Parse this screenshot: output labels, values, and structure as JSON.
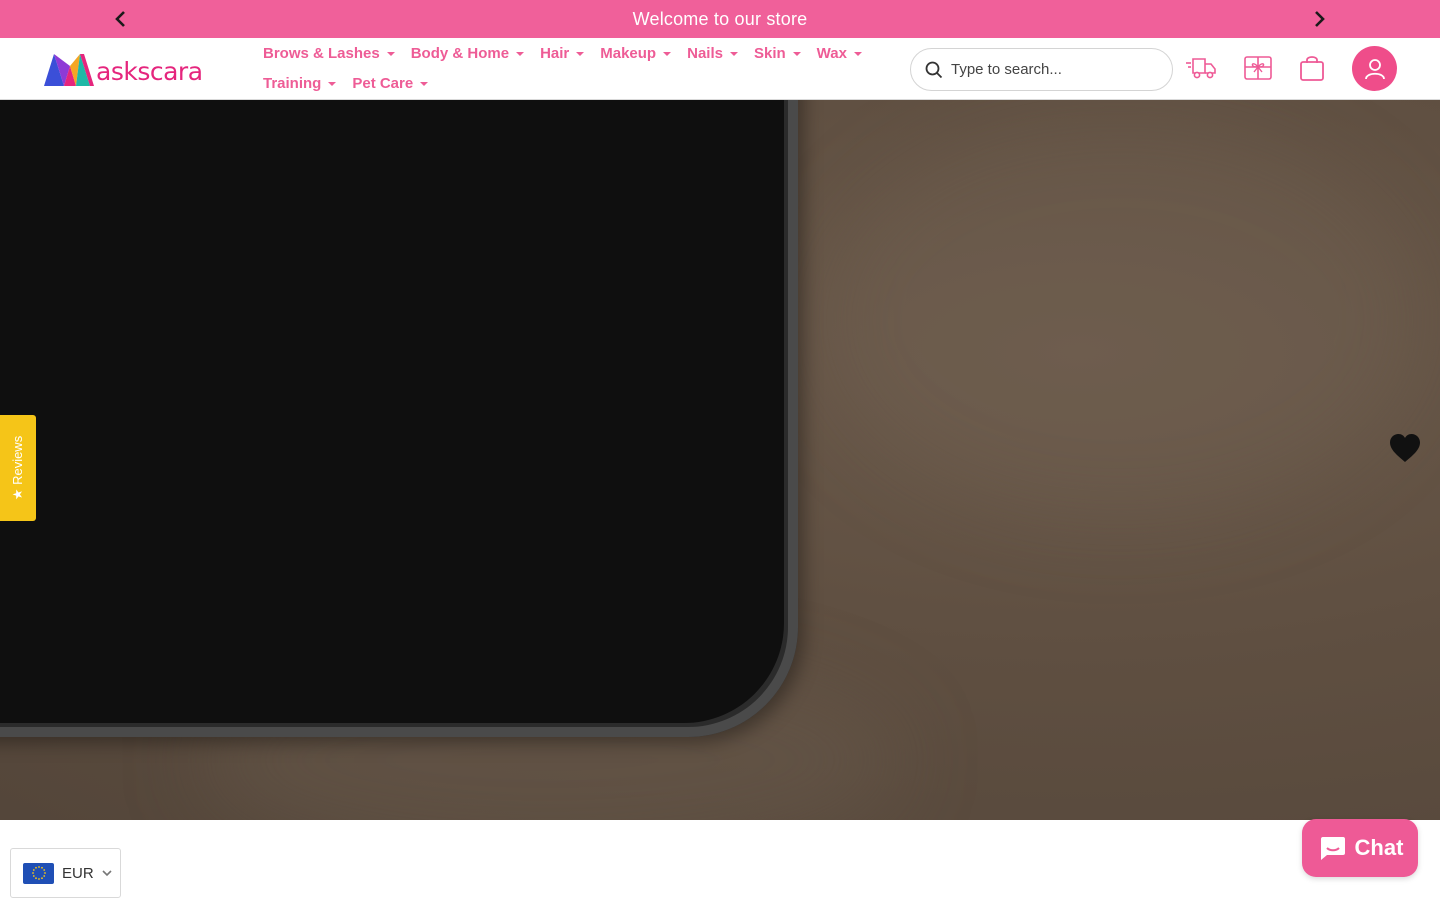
{
  "announcement": {
    "message": "Welcome to our store",
    "prev_icon": "chevron-left-icon",
    "next_icon": "chevron-right-icon"
  },
  "brand": {
    "wordmark": "askscara",
    "accent_color": "#f0609a",
    "logo_color": "#e5257d"
  },
  "nav": {
    "row1": [
      {
        "label": "Brows & Lashes"
      },
      {
        "label": "Body & Home"
      },
      {
        "label": "Hair"
      },
      {
        "label": "Makeup"
      },
      {
        "label": "Nails"
      },
      {
        "label": "Skin"
      },
      {
        "label": "Wax"
      }
    ],
    "row2": [
      {
        "label": "Training"
      },
      {
        "label": "Pet Care"
      }
    ]
  },
  "search": {
    "placeholder": "Type to search...",
    "value": ""
  },
  "header_icons": [
    "delivery-truck-icon",
    "gift-card-icon",
    "shopping-bag-icon",
    "account-icon"
  ],
  "reviews_tab": {
    "label": "★ Reviews",
    "color": "#f5c518"
  },
  "currency": {
    "code": "EUR",
    "flag": "eu-flag-icon"
  },
  "chat": {
    "label": "Chat"
  }
}
